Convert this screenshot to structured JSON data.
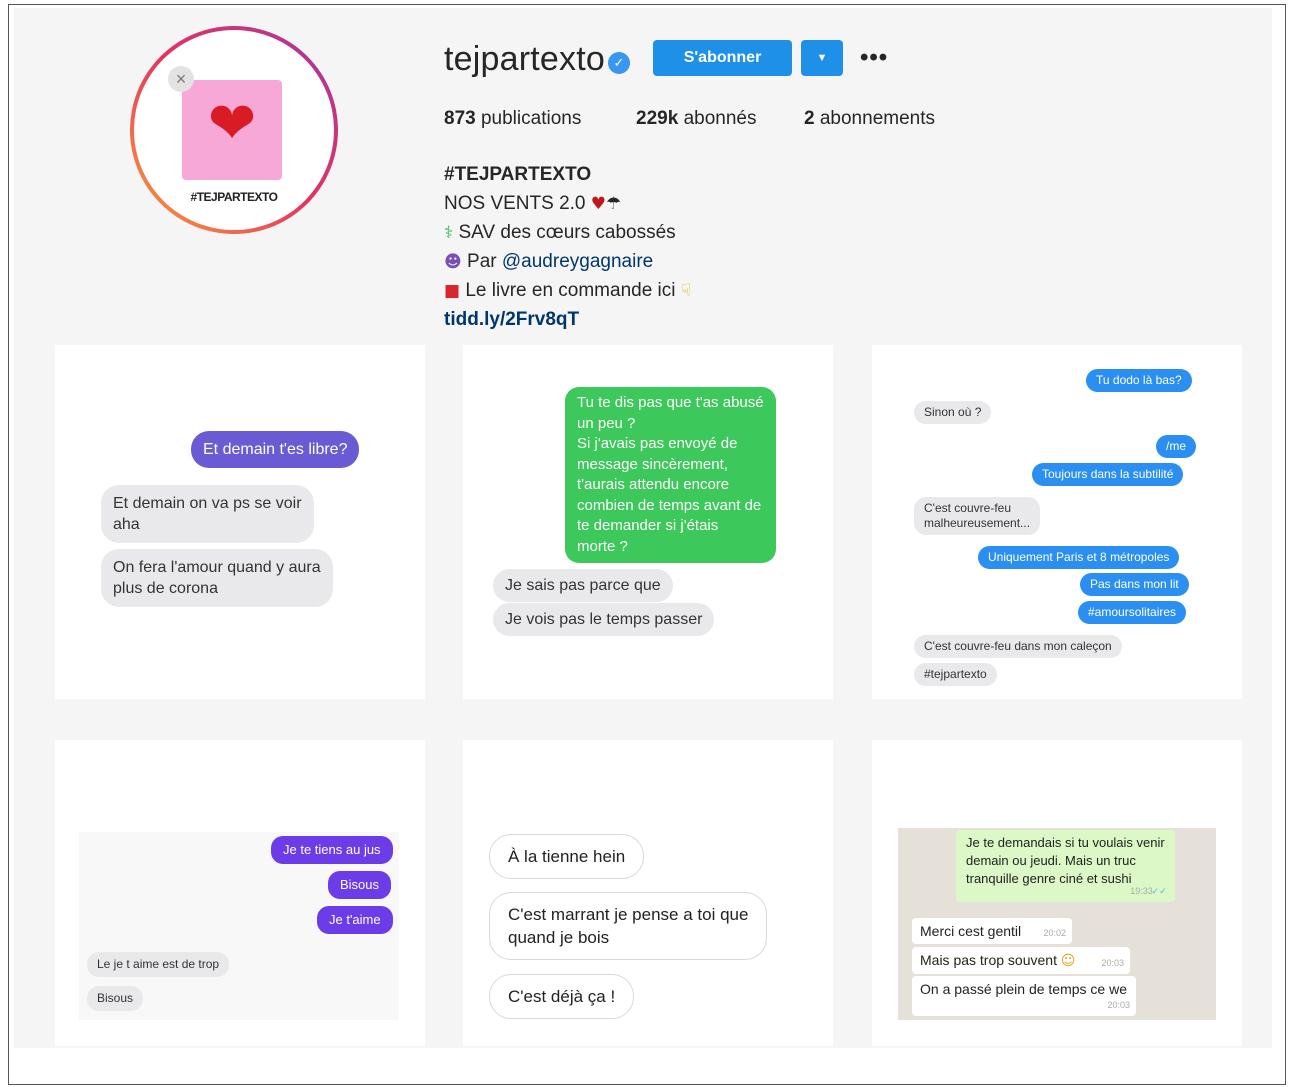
{
  "profile": {
    "username": "tejpartexto",
    "follow_label": "S'abonner",
    "avatar_tag": "#TEJPARTEXTO",
    "stats": {
      "publications_count": "873",
      "publications_label": "publications",
      "followers_count": "229k",
      "followers_label": "abonnés",
      "following_count": "2",
      "following_label": "abonnements"
    },
    "bio": {
      "title": "#TEJPARTEXTO",
      "line1": "NOS VENTS 2.0",
      "line2": "SAV des cœurs cabossés",
      "line3_prefix": "Par",
      "line3_mention": "@audreygagnaire",
      "line4": "Le livre en commande ici",
      "link": "tidd.ly/2Frv8qT"
    }
  },
  "posts": [
    {
      "messages": [
        "Et demain t'es libre?",
        "Et demain on va ps se voir",
        "aha",
        "On fera l'amour quand y aura",
        "plus de corona"
      ]
    },
    {
      "messages": [
        "Tu te dis pas que t'as abusé",
        "un peu ?",
        "Si j'avais pas envoyé de",
        "message sincèrement,",
        "t'aurais attendu encore",
        "combien de temps avant de",
        "te demander si j'étais",
        "morte ?",
        "Je sais pas parce que",
        "Je vois pas le temps passer"
      ]
    },
    {
      "messages": [
        "Tu dodo là bas?",
        "Sinon où ?",
        "/me",
        "Toujours dans la subtilité",
        "C'est couvre-feu",
        "malheureusement...",
        "Uniquement Paris et 8 métropoles",
        "Pas dans mon lit",
        "#amoursolitaires",
        "C'est couvre-feu dans mon caleçon",
        "#tejpartexto"
      ]
    },
    {
      "messages": [
        "Je te tiens au jus",
        "Bisous",
        "Je t'aime",
        "Le je t aime est de trop",
        "Bisous"
      ]
    },
    {
      "messages": [
        "À la tienne hein",
        "C'est marrant je pense a toi que",
        "quand je bois",
        "C'est déjà ça !"
      ]
    },
    {
      "messages": [
        "Je te demandais si tu voulais venir",
        "demain ou jeudi. Mais un truc",
        "tranquille genre ciné et sushi",
        "Merci cest gentil",
        "Mais pas trop souvent",
        "On a passé plein de temps ce we"
      ],
      "times": [
        "19:33",
        "20:02",
        "20:03",
        "20:03"
      ]
    }
  ],
  "icons": {
    "verified": "verified-badge-icon",
    "dropdown": "chevron-down-icon",
    "more": "more-options-icon"
  },
  "colors": {
    "follow_button": "#1e90e8",
    "link": "#00376b",
    "imessage_blue": "#2a8ff0",
    "imessage_green": "#3cc85a"
  }
}
